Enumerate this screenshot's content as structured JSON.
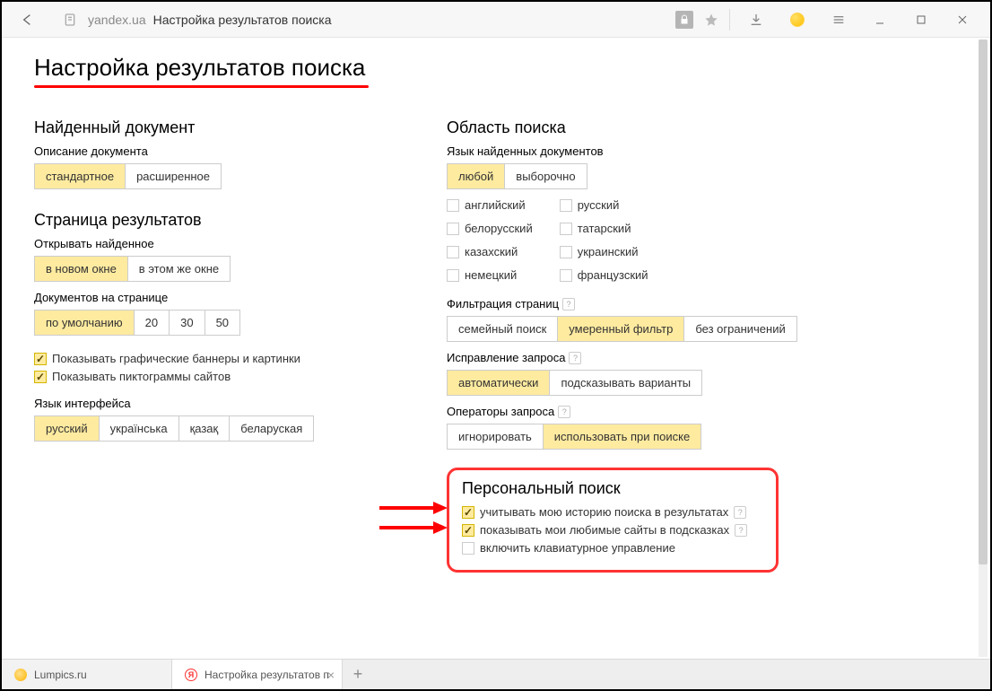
{
  "browser": {
    "domain": "yandex.ua",
    "page_title": "Настройка результатов поиска"
  },
  "page": {
    "heading": "Настройка результатов поиска"
  },
  "left": {
    "section1_title": "Найденный документ",
    "doc_desc_label": "Описание документа",
    "doc_desc_opts": [
      "стандартное",
      "расширенное"
    ],
    "section2_title": "Страница результатов",
    "open_label": "Открывать найденное",
    "open_opts": [
      "в новом окне",
      "в этом же окне"
    ],
    "perpage_label": "Документов на странице",
    "perpage_opts": [
      "по умолчанию",
      "20",
      "30",
      "50"
    ],
    "chk_banners": "Показывать графические баннеры и картинки",
    "chk_favicons": "Показывать пиктограммы сайтов",
    "lang_ui_label": "Язык интерфейса",
    "lang_ui_opts": [
      "русский",
      "українська",
      "қазақ",
      "беларуская"
    ]
  },
  "right": {
    "section1_title": "Область поиска",
    "lang_docs_label": "Язык найденных документов",
    "lang_docs_opts": [
      "любой",
      "выборочно"
    ],
    "lang_col1": [
      "английский",
      "белорусский",
      "казахский",
      "немецкий"
    ],
    "lang_col2": [
      "русский",
      "татарский",
      "украинский",
      "французский"
    ],
    "filter_label": "Фильтрация страниц",
    "filter_opts": [
      "семейный поиск",
      "умеренный фильтр",
      "без ограничений"
    ],
    "correct_label": "Исправление запроса",
    "correct_opts": [
      "автоматически",
      "подсказывать варианты"
    ],
    "ops_label": "Операторы запроса",
    "ops_opts": [
      "игнорировать",
      "использовать при поиске"
    ]
  },
  "personal": {
    "title": "Персональный поиск",
    "chk_history": "учитывать мою историю поиска в результатах",
    "chk_favorites": "показывать мои любимые сайты в подсказках",
    "chk_keyboard": "включить клавиатурное управление"
  },
  "tabs": {
    "tab1": "Lumpics.ru",
    "tab2": "Настройка результатов п"
  }
}
